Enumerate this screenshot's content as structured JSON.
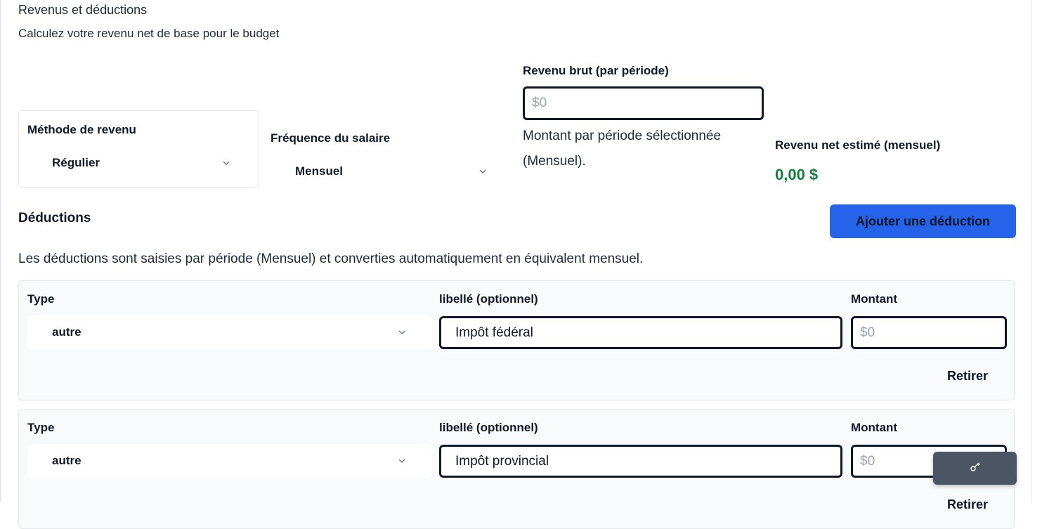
{
  "header": {
    "title": "Revenus et déductions",
    "subtitle": "Calculez votre revenu net de base pour le budget"
  },
  "income": {
    "method_label": "Méthode de revenu",
    "method_value": "Régulier",
    "frequency_label": "Fréquence du salaire",
    "frequency_value": "Mensuel",
    "gross_label": "Revenu brut (par période)",
    "gross_placeholder": "$0",
    "gross_help": "Montant par période sélectionnée (Mensuel).",
    "net_label": "Revenu net estimé (mensuel)",
    "net_value": "0,00 $"
  },
  "deductions": {
    "title": "Déductions",
    "add_button": "Ajouter une déduction",
    "description": "Les déductions sont saisies par période (Mensuel) et converties automatiquement en équivalent mensuel.",
    "type_label": "Type",
    "label_label": "libellé (optionnel)",
    "amount_label": "Montant",
    "remove_label": "Retirer",
    "items": [
      {
        "type": "autre",
        "label": "Impôt fédéral",
        "amount_placeholder": "$0"
      },
      {
        "type": "autre",
        "label": "Impôt provincial",
        "amount_placeholder": "$0"
      }
    ]
  },
  "floating": {
    "icon": "key-icon"
  },
  "colors": {
    "accent": "#2563eb",
    "positive": "#15803d",
    "floating_bg": "#4b5563"
  }
}
